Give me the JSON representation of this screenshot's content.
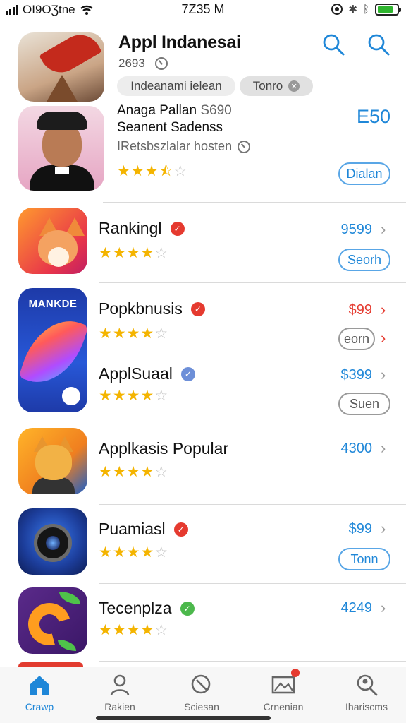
{
  "status_bar": {
    "carrier": "OI9OƷtne",
    "time": "7Z35 M"
  },
  "header": {
    "title": "Appl Indanesai",
    "subtitle": "2693",
    "chips": [
      {
        "label": "Indeanami ielean"
      },
      {
        "label": "Tonro"
      }
    ]
  },
  "featured": {
    "line1": "Anaga Pallan",
    "line1_code": "S690",
    "line2": "Seanent Sadenss",
    "line3": "IRetsbszlalar hosten",
    "price": "E50",
    "rating": 3.5,
    "action_label": "Dialan"
  },
  "apps": [
    {
      "name": "Rankingl",
      "badge_color": "#e53a2f",
      "rating": 4,
      "price": "9599",
      "price_color": "#1f87d8",
      "action_label": "Seorh",
      "action_style": "blue"
    },
    {
      "name": "Popkbnusis",
      "badge_color": "#e53a2f",
      "rating": 4,
      "price": "$99",
      "price_color": "#e53a2f",
      "action_label": "eorn",
      "action_style": "grey",
      "icon_label": "MANKDE"
    },
    {
      "name": "ApplSuaal",
      "badge_color": "#6d8fd8",
      "rating": 4,
      "price": "$399",
      "price_color": "#1f87d8",
      "action_label": "Suen",
      "action_style": "grey"
    },
    {
      "name": "Applkasis Popular",
      "rating": 4,
      "price": "4300",
      "price_color": "#1f87d8"
    },
    {
      "name": "Puamiasl",
      "badge_color": "#e53a2f",
      "rating": 4,
      "price": "$99",
      "price_color": "#1f87d8",
      "action_label": "Tonn",
      "action_style": "blue"
    },
    {
      "name": "Tecenplza",
      "badge_color": "#4cb84c",
      "rating": 4,
      "price": "4249",
      "price_color": "#1f87d8"
    }
  ],
  "tabs": [
    {
      "label": "Crawp",
      "icon": "home-icon",
      "active": true
    },
    {
      "label": "Rakien",
      "icon": "person-icon"
    },
    {
      "label": "Sciesan",
      "icon": "search-icon"
    },
    {
      "label": "Crnenian",
      "icon": "image-icon",
      "notification": true
    },
    {
      "label": "Ihariscms",
      "icon": "search-person-icon"
    }
  ],
  "colors": {
    "accent": "#1f87d8",
    "star": "#f4b400",
    "alert": "#e53a2f"
  }
}
